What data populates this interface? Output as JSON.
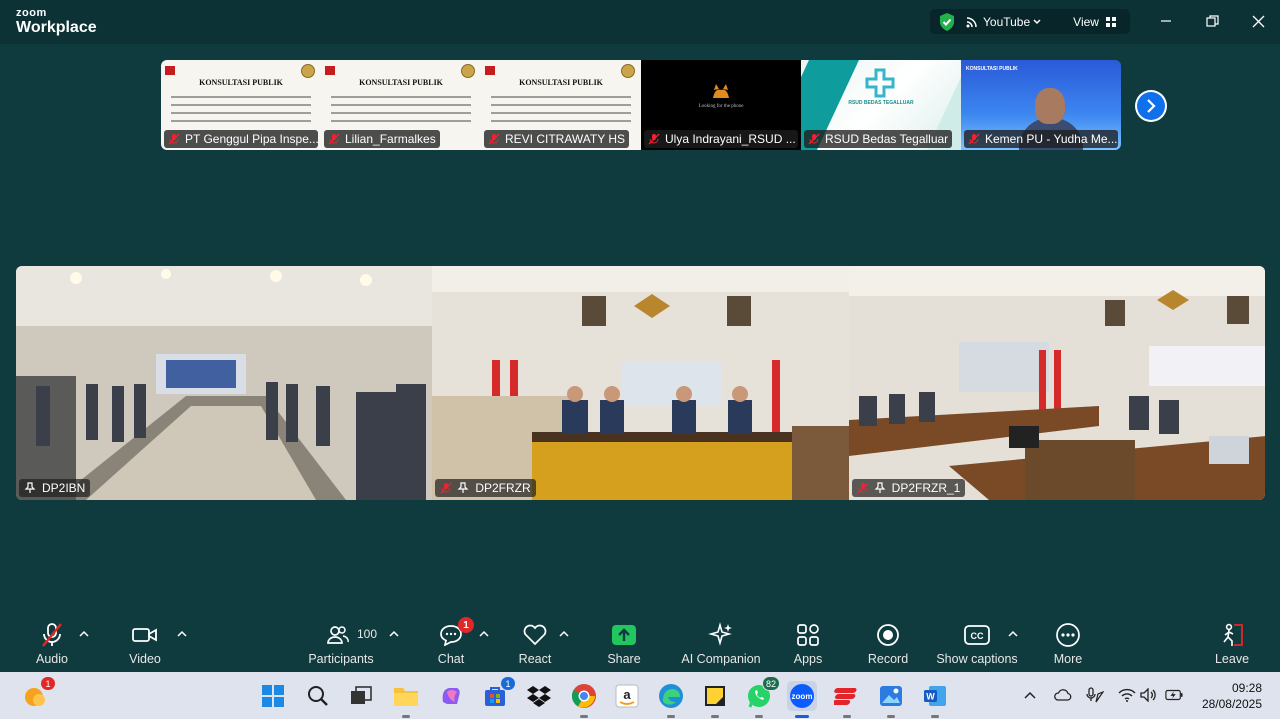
{
  "app": {
    "brand_top": "zoom",
    "brand_bottom": "Workplace"
  },
  "header": {
    "stream_label": "YouTube",
    "view_label": "View"
  },
  "thumbnails": [
    {
      "name": "PT Genggul Pipa Inspe...",
      "kind": "document",
      "doc_title": "KONSULTASI PUBLIK"
    },
    {
      "name": "Lilian_Farmalkes",
      "kind": "document",
      "doc_title": "KONSULTASI PUBLIK"
    },
    {
      "name": "REVI CITRAWATY HS",
      "kind": "document",
      "doc_title": "KONSULTASI PUBLIK"
    },
    {
      "name": "Ulya Indrayani_RSUD ...",
      "kind": "black",
      "message": "Looking for the phone"
    },
    {
      "name": "RSUD Bedas Tegalluar",
      "kind": "logo",
      "logo_text": "RSUD BEDAS TEGALLUAR"
    },
    {
      "name": "Kemen PU - Yudha Me...",
      "kind": "camera",
      "slide_title": "KONSULTASI PUBLIK"
    }
  ],
  "main_videos": [
    {
      "name": "DP2IBN"
    },
    {
      "name": "DP2FRZR"
    },
    {
      "name": "DP2FRZR_1"
    }
  ],
  "toolbar": {
    "audio": "Audio",
    "video": "Video",
    "participants": "Participants",
    "participants_count": "100",
    "chat": "Chat",
    "chat_badge": "1",
    "react": "React",
    "share": "Share",
    "ai": "AI Companion",
    "apps": "Apps",
    "record": "Record",
    "captions": "Show captions",
    "more": "More",
    "leave": "Leave"
  },
  "taskbar": {
    "weather_badge": "1",
    "store_badge": "1",
    "whatsapp_badge": "82",
    "time": "09:28",
    "date": "28/08/2025",
    "zoom_icon_text": "zoom"
  },
  "colors": {
    "share_green": "#22c55e",
    "meeting_bg": "#0f3a3e",
    "badge_red": "#e02828"
  }
}
